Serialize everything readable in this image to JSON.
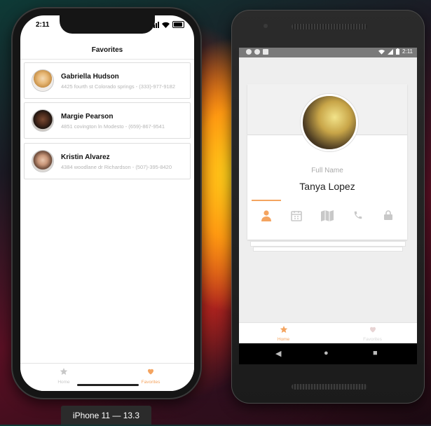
{
  "ios": {
    "time": "2:11",
    "nav_title": "Favorites",
    "contacts": [
      {
        "name": "Gabriella Hudson",
        "address": "4425 fourth st Colorado springs - (333)-977-9182"
      },
      {
        "name": "Margie Pearson",
        "address": "4851 covington ln Modesto - (659)-867-9541"
      },
      {
        "name": "Kristin Alvarez",
        "address": "4384 woodlane dr Richardson - (507)-395-8420"
      }
    ],
    "tabs": [
      {
        "label": "Home",
        "icon": "star-icon",
        "active": false
      },
      {
        "label": "Favorites",
        "icon": "heart-icon",
        "active": true
      }
    ],
    "simulator_label": "iPhone 11 — 13.3"
  },
  "android": {
    "time": "2:11",
    "profile": {
      "label": "Full Name",
      "name": "Tanya Lopez"
    },
    "profile_tabs": [
      "person-icon",
      "calendar-icon",
      "map-icon",
      "phone-icon",
      "lock-icon"
    ],
    "tabs": [
      {
        "label": "Home",
        "icon": "star-icon",
        "active": true
      },
      {
        "label": "Favorites",
        "icon": "heart-icon",
        "active": false
      }
    ]
  },
  "colors": {
    "accent": "#f4a460",
    "inactive": "#c8c8c8"
  }
}
